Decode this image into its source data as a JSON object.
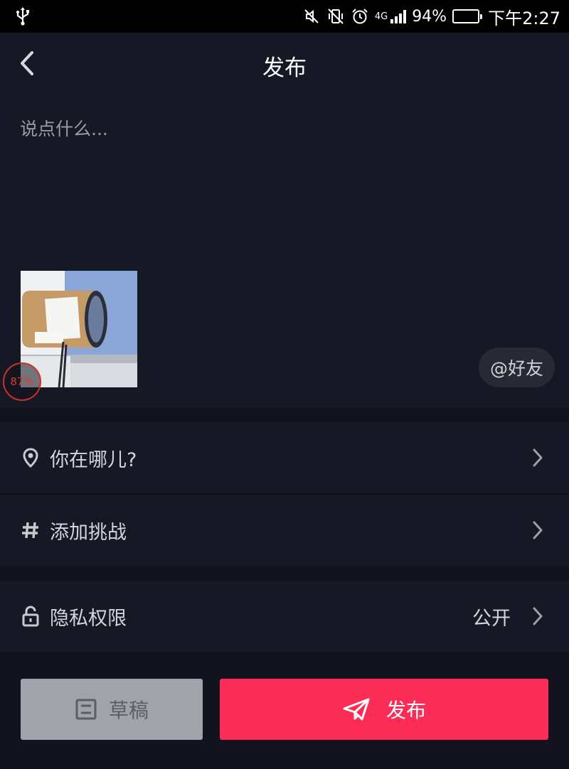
{
  "status_bar": {
    "network": "4G",
    "battery_percent": "94%",
    "battery_level": 0.94,
    "time": "下午2:27",
    "icons": [
      "usb-icon",
      "mute-icon",
      "vibrate-off-icon",
      "alarm-icon",
      "signal-icon",
      "battery-icon"
    ]
  },
  "header": {
    "title": "发布",
    "back_icon": "chevron-left-icon"
  },
  "compose": {
    "placeholder": "说点什么...",
    "upload_progress": "87%",
    "mention_label": "@好友"
  },
  "options": {
    "location": {
      "label": "你在哪儿?",
      "icon": "location-pin-icon"
    },
    "challenge": {
      "label": "添加挑战",
      "icon": "hashtag-icon"
    },
    "privacy": {
      "label": "隐私权限",
      "value": "公开",
      "icon": "unlock-icon"
    }
  },
  "actions": {
    "draft_label": "草稿",
    "publish_label": "发布"
  },
  "colors": {
    "background": "#12131e",
    "panel": "#161826",
    "accent": "#fb2c55",
    "draft_button": "#a1a2aa",
    "battery_fill": "#32e03a"
  }
}
